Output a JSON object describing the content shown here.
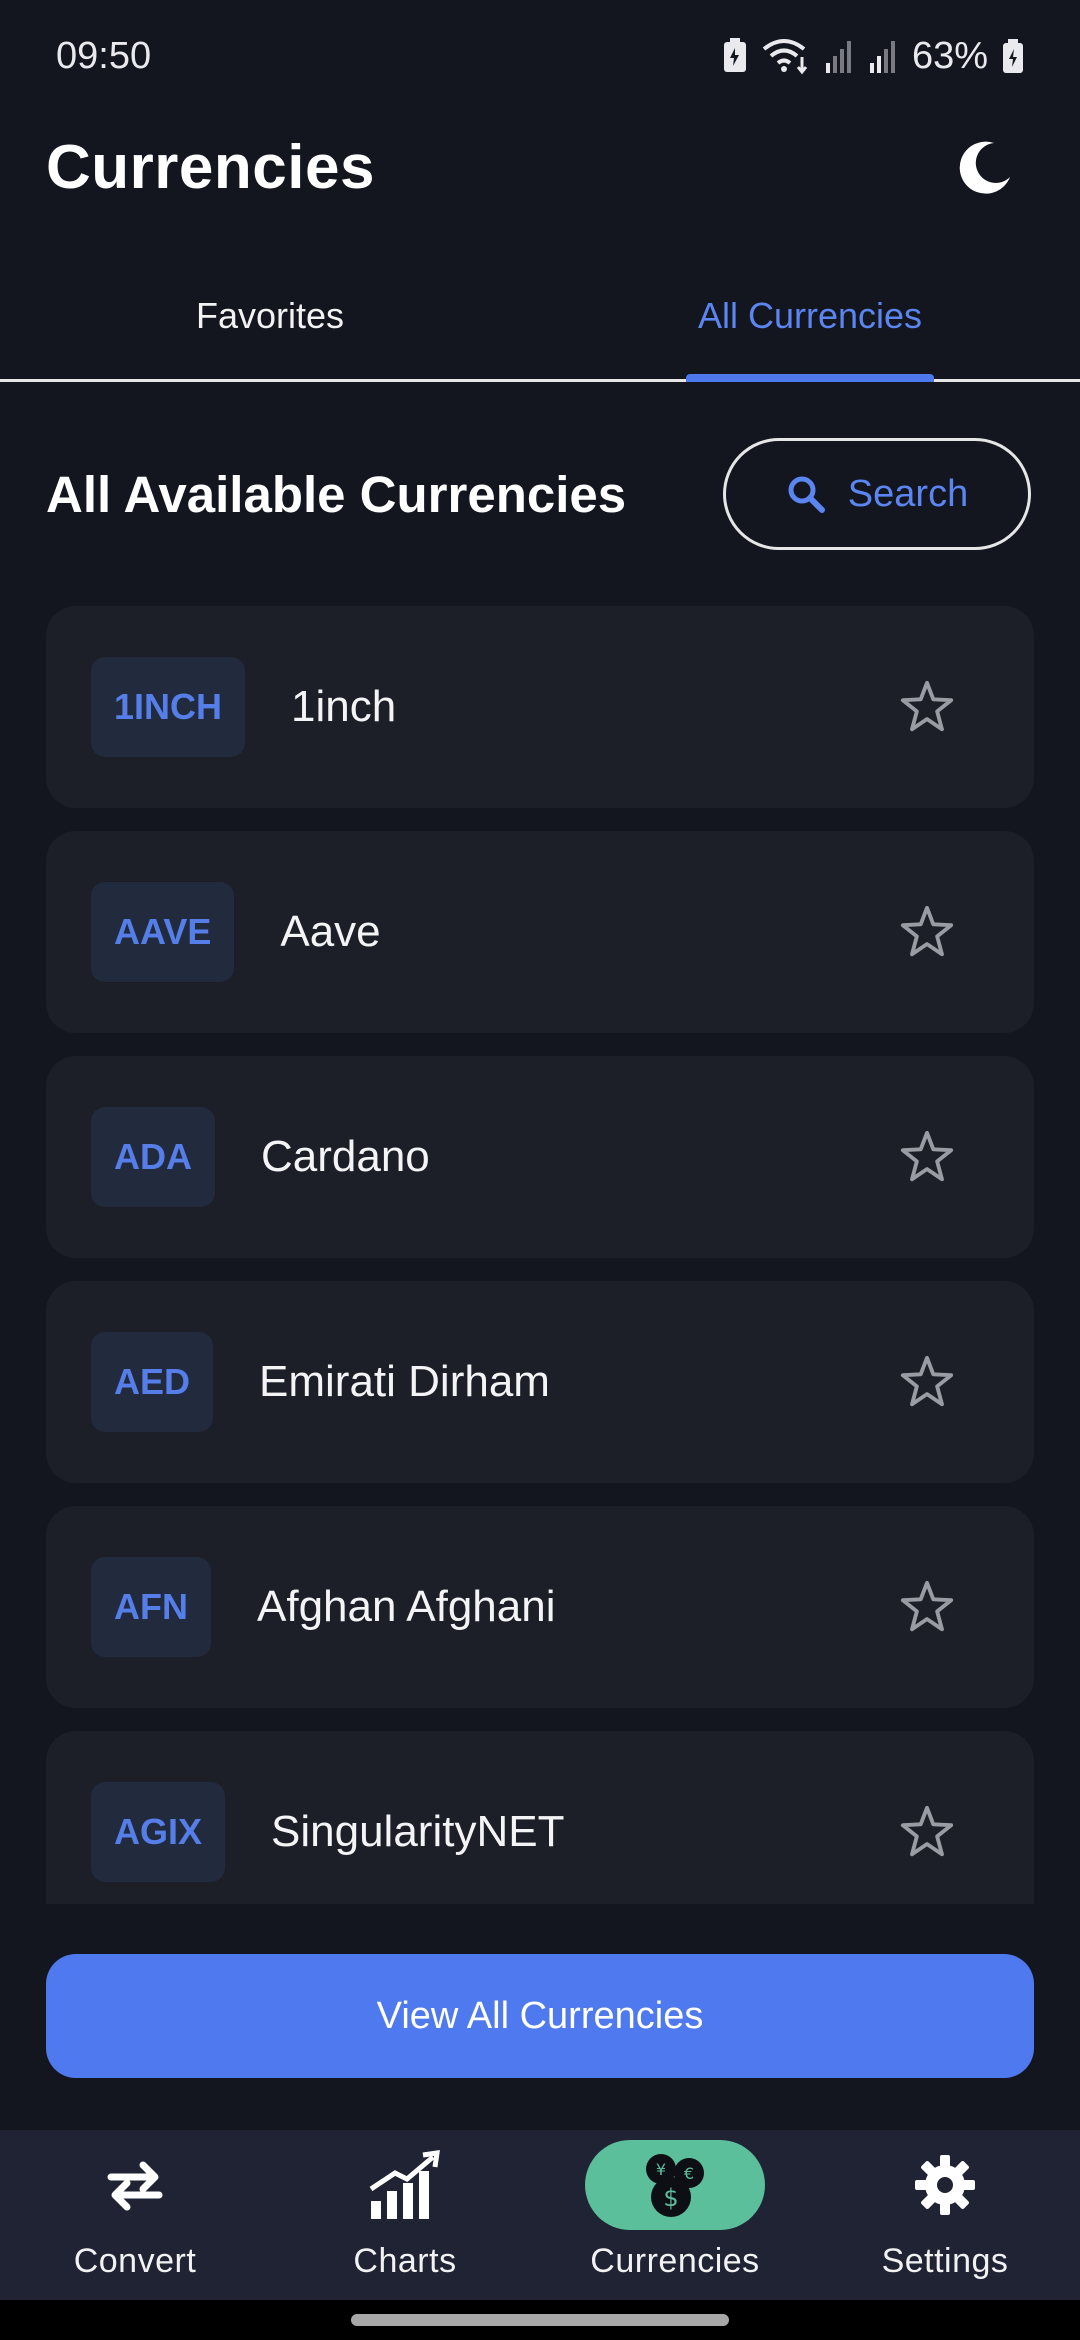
{
  "status_bar": {
    "time": "09:50",
    "battery": "63%"
  },
  "header": {
    "title": "Currencies",
    "theme_icon": "moon-icon"
  },
  "tabs": [
    {
      "label": "Favorites",
      "active": false
    },
    {
      "label": "All Currencies",
      "active": true
    }
  ],
  "section": {
    "title": "All Available Currencies",
    "search_label": "Search"
  },
  "currencies": [
    {
      "code": "1INCH",
      "name": "1inch",
      "favorite": false
    },
    {
      "code": "AAVE",
      "name": "Aave",
      "favorite": false
    },
    {
      "code": "ADA",
      "name": "Cardano",
      "favorite": false
    },
    {
      "code": "AED",
      "name": "Emirati Dirham",
      "favorite": false
    },
    {
      "code": "AFN",
      "name": "Afghan Afghani",
      "favorite": false
    },
    {
      "code": "AGIX",
      "name": "SingularityNET",
      "favorite": false
    }
  ],
  "view_all_label": "View All Currencies",
  "bottom_nav": [
    {
      "label": "Convert",
      "icon": "swap-arrows-icon",
      "active": false
    },
    {
      "label": "Charts",
      "icon": "chart-icon",
      "active": false
    },
    {
      "label": "Currencies",
      "icon": "coins-icon",
      "active": true
    },
    {
      "label": "Settings",
      "icon": "gear-icon",
      "active": false
    }
  ],
  "colors": {
    "background": "#13161f",
    "card": "#1c1f28",
    "accent": "#4f79ee",
    "active_nav": "#5cbf9c"
  }
}
